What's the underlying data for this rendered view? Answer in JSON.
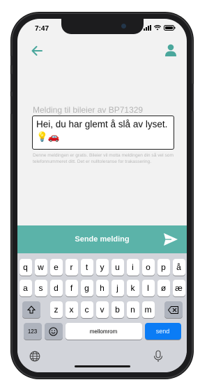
{
  "status": {
    "time": "7:47"
  },
  "nav": {
    "back_icon": "arrow-left-icon",
    "user_icon": "user-icon",
    "accent": "#4aa79c"
  },
  "message": {
    "label": "Melding til bileier av BP71329",
    "text": "Hei, du har glemt å slå av lyset. 💡🚗",
    "disclaimer": "Denne meldingen er gratis. Bileier vil motta meldingen din så vel som telefonnummeret ditt. Det er nulltoleranse for trakassering."
  },
  "send_bar": {
    "label": "Sende melding",
    "icon": "paper-plane-icon",
    "color": "#5bb3a9"
  },
  "keyboard": {
    "row1": [
      "q",
      "w",
      "e",
      "r",
      "t",
      "y",
      "u",
      "i",
      "o",
      "p",
      "å"
    ],
    "row2": [
      "a",
      "s",
      "d",
      "f",
      "g",
      "h",
      "j",
      "k",
      "l",
      "ø",
      "æ"
    ],
    "row3": [
      "z",
      "x",
      "c",
      "v",
      "b",
      "n",
      "m"
    ],
    "numbers_label": "123",
    "space_label": "mellomrom",
    "send_label": "send",
    "send_color": "#0b7cf5"
  }
}
